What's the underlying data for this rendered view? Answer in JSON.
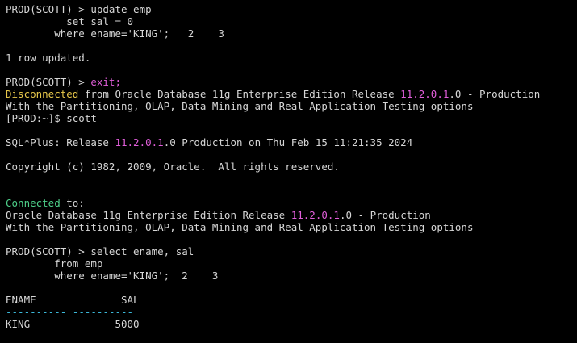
{
  "terminal": {
    "colors": {
      "background": "#000000",
      "foreground": "#d6d6d6",
      "yellow": "#e7c74a",
      "magenta": "#e05ed9",
      "green": "#4ed08a",
      "cyan": "#3bb7d8"
    },
    "lines": [
      [
        {
          "t": "PROD(SCOTT) > update emp"
        }
      ],
      [
        {
          "t": "          set sal = 0"
        }
      ],
      [
        {
          "t": "        where ename='KING';   2    3"
        }
      ],
      [
        {
          "t": ""
        }
      ],
      [
        {
          "t": "1 row updated."
        }
      ],
      [
        {
          "t": ""
        }
      ],
      [
        {
          "t": "PROD(SCOTT) > "
        },
        {
          "t": "exit;",
          "c": "magenta"
        }
      ],
      [
        {
          "t": "Disconnected",
          "c": "yellow"
        },
        {
          "t": " from Oracle Database 11g Enterprise Edition Release "
        },
        {
          "t": "11.2.0.1",
          "c": "magenta"
        },
        {
          "t": ".0 - Production"
        }
      ],
      [
        {
          "t": "With the Partitioning, OLAP, Data Mining and Real Application Testing options"
        }
      ],
      [
        {
          "t": "[PROD:~]$ scott"
        }
      ],
      [
        {
          "t": ""
        }
      ],
      [
        {
          "t": "SQL*Plus: Release "
        },
        {
          "t": "11.2.0.1",
          "c": "magenta"
        },
        {
          "t": ".0 Production on Thu Feb 15 11:21:35 2024"
        }
      ],
      [
        {
          "t": ""
        }
      ],
      [
        {
          "t": "Copyright (c) 1982, 2009, Oracle.  All rights reserved."
        }
      ],
      [
        {
          "t": ""
        }
      ],
      [
        {
          "t": ""
        }
      ],
      [
        {
          "t": "Connected",
          "c": "green"
        },
        {
          "t": " to:"
        }
      ],
      [
        {
          "t": "Oracle Database 11g Enterprise Edition Release "
        },
        {
          "t": "11.2.0.1",
          "c": "magenta"
        },
        {
          "t": ".0 - Production"
        }
      ],
      [
        {
          "t": "With the Partitioning, OLAP, Data Mining and Real Application Testing options"
        }
      ],
      [
        {
          "t": ""
        }
      ],
      [
        {
          "t": "PROD(SCOTT) > select ename, sal"
        }
      ],
      [
        {
          "t": "        from emp"
        }
      ],
      [
        {
          "t": "        where ename='KING';  2    3"
        }
      ],
      [
        {
          "t": ""
        }
      ],
      [
        {
          "t": "ENAME              SAL"
        }
      ],
      [
        {
          "t": "----------",
          "c": "cyan"
        },
        {
          "t": " "
        },
        {
          "t": "----------",
          "c": "cyan"
        }
      ],
      [
        {
          "t": "KING              5000"
        }
      ]
    ]
  }
}
